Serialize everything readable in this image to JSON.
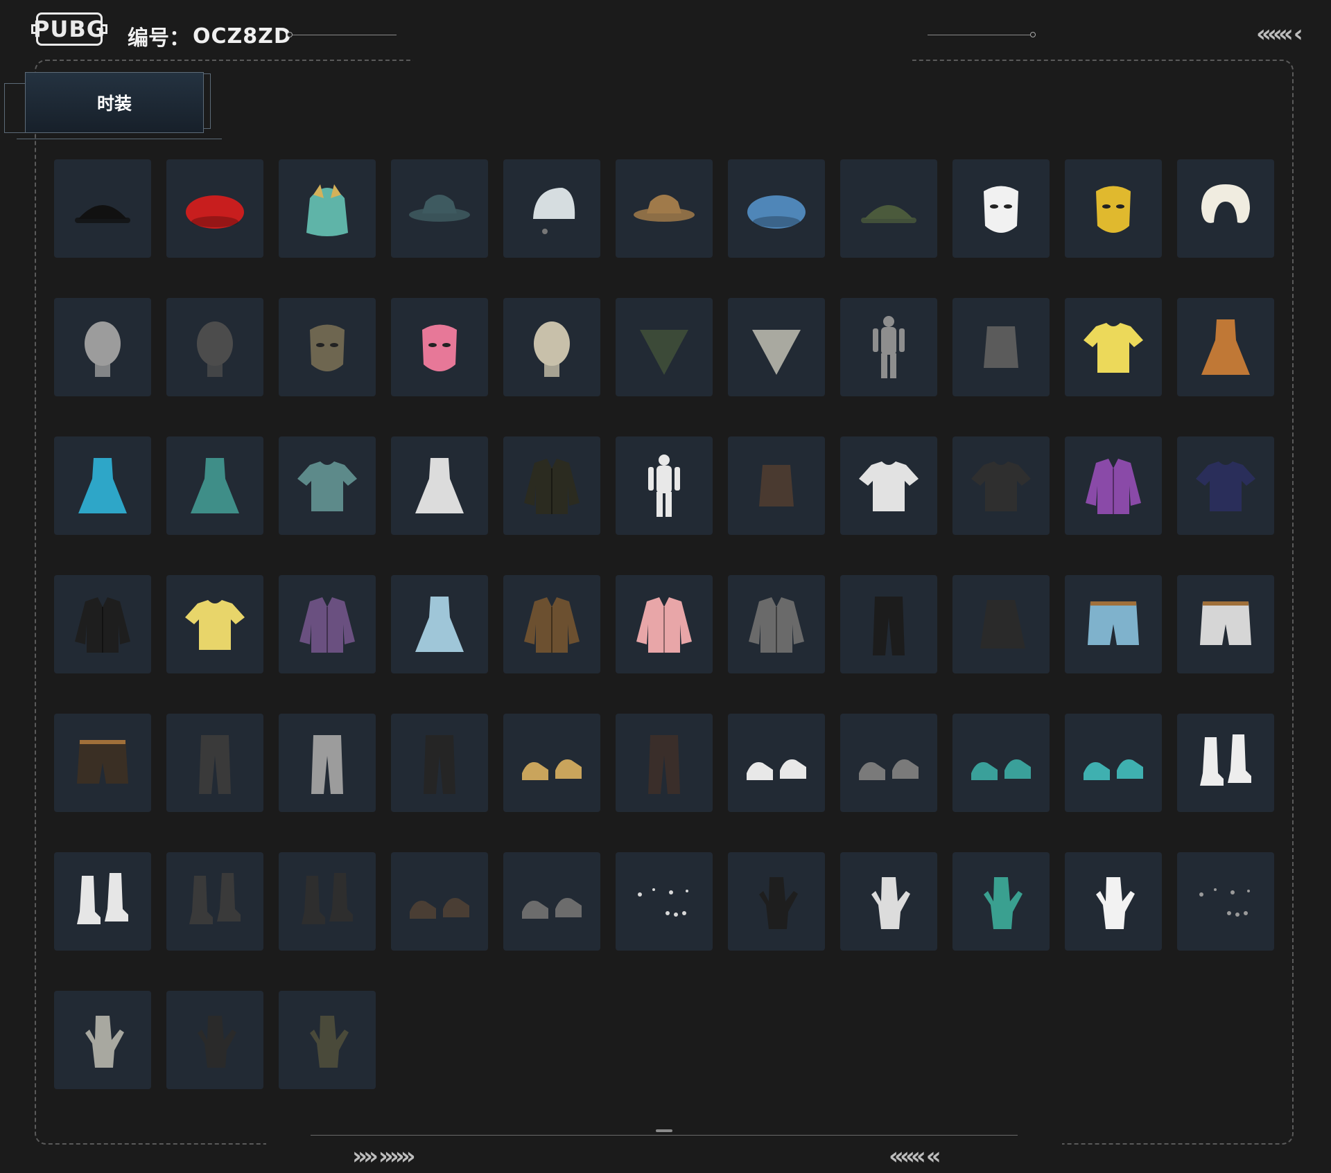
{
  "header": {
    "logo_text": "PUBG",
    "code_label": "编号：",
    "code_value": "OCZ8ZD",
    "chevrons_top_right": "«««  ‹"
  },
  "tabs": [
    {
      "label": "时装",
      "active": true
    }
  ],
  "footer": {
    "chevrons_left": "»» »»»",
    "chevrons_right": "««« «"
  },
  "colors": {
    "background": "#1b1b1b",
    "tile": "#222a34",
    "accent": "#5d6b78"
  },
  "items": [
    {
      "icon": "black-cap-icon",
      "color": "#111111",
      "shape": "cap"
    },
    {
      "icon": "red-beret-icon",
      "color": "#c81e1e",
      "shape": "beret"
    },
    {
      "icon": "furry-hat-icon",
      "color": "#5fb4a8",
      "shape": "fur"
    },
    {
      "icon": "bucket-hat-teal-icon",
      "color": "#3e5a60",
      "shape": "bucket"
    },
    {
      "icon": "white-beanie-icon",
      "color": "#d6dde0",
      "shape": "beanie"
    },
    {
      "icon": "leopard-bucket-hat-icon",
      "color": "#a07a4a",
      "shape": "bucket"
    },
    {
      "icon": "blue-plaid-beret-icon",
      "color": "#4f86b8",
      "shape": "beret"
    },
    {
      "icon": "headset-cap-icon",
      "color": "#4b5a3c",
      "shape": "cap"
    },
    {
      "icon": "chicken-mask-icon",
      "color": "#f1f1f1",
      "shape": "mask"
    },
    {
      "icon": "gold-mask-icon",
      "color": "#e0b92e",
      "shape": "mask"
    },
    {
      "icon": "neck-pillow-icon",
      "color": "#f0ece0",
      "shape": "pillow"
    },
    {
      "icon": "bald-head-icon",
      "color": "#9c9c9c",
      "shape": "head"
    },
    {
      "icon": "tactical-mask-icon",
      "color": "#4c4c4c",
      "shape": "head"
    },
    {
      "icon": "wolf-mask-icon",
      "color": "#6e6650",
      "shape": "mask"
    },
    {
      "icon": "pink-mask-icon",
      "color": "#e77898",
      "shape": "mask"
    },
    {
      "icon": "skull-mask-icon",
      "color": "#c8c0aa",
      "shape": "head"
    },
    {
      "icon": "bandana-green-icon",
      "color": "#3c4a38",
      "shape": "bandana"
    },
    {
      "icon": "bandana-checkered-icon",
      "color": "#a9a9a0",
      "shape": "bandana"
    },
    {
      "icon": "full-suit-icon",
      "color": "#8e8e8e",
      "shape": "suit"
    },
    {
      "icon": "chain-top-icon",
      "color": "#5b5b5b",
      "shape": "top"
    },
    {
      "icon": "yellow-tshirt-icon",
      "color": "#ecd95a",
      "shape": "shirt"
    },
    {
      "icon": "leopard-dress-icon",
      "color": "#c07836",
      "shape": "dress"
    },
    {
      "icon": "blue-dress-icon",
      "color": "#2ea6c8",
      "shape": "dress"
    },
    {
      "icon": "teal-dress-icon",
      "color": "#3f8e88",
      "shape": "dress"
    },
    {
      "icon": "floral-shirt-icon",
      "color": "#5d8a8a",
      "shape": "shirt"
    },
    {
      "icon": "white-outfit-icon",
      "color": "#dcdcdc",
      "shape": "dress"
    },
    {
      "icon": "black-jacket-gold-icon",
      "color": "#2b2b20",
      "shape": "jacket"
    },
    {
      "icon": "spotted-outfit-icon",
      "color": "#e8e8e8",
      "shape": "suit"
    },
    {
      "icon": "leather-vest-icon",
      "color": "#4a3a30",
      "shape": "top"
    },
    {
      "icon": "white-shirt-icon",
      "color": "#e2e2e2",
      "shape": "shirt"
    },
    {
      "icon": "black-tshirt-icon",
      "color": "#2f2f2f",
      "shape": "shirt"
    },
    {
      "icon": "purple-jacket-icon",
      "color": "#8a4aa8",
      "shape": "jacket"
    },
    {
      "icon": "navy-sweater-icon",
      "color": "#2a2e5a",
      "shape": "shirt"
    },
    {
      "icon": "black-hoodie-icon",
      "color": "#1e1e1e",
      "shape": "jacket"
    },
    {
      "icon": "yellow-sweater-icon",
      "color": "#e8d56a",
      "shape": "shirt"
    },
    {
      "icon": "purple-bomber-icon",
      "color": "#6a5080",
      "shape": "jacket"
    },
    {
      "icon": "nurse-outfit-icon",
      "color": "#9fc6d8",
      "shape": "dress"
    },
    {
      "icon": "leopard-coat-icon",
      "color": "#6c5030",
      "shape": "jacket"
    },
    {
      "icon": "pink-hoodie-icon",
      "color": "#e8a6a8",
      "shape": "jacket"
    },
    {
      "icon": "grey-jacket-icon",
      "color": "#6a6a6a",
      "shape": "jacket"
    },
    {
      "icon": "black-pants-icon",
      "color": "#1c1c1c",
      "shape": "pants"
    },
    {
      "icon": "black-skirt-icon",
      "color": "#2a2a2a",
      "shape": "skirt"
    },
    {
      "icon": "denim-shorts-icon",
      "color": "#7fb2cc",
      "shape": "shorts"
    },
    {
      "icon": "white-shorts-icon",
      "color": "#d6d6d6",
      "shape": "shorts"
    },
    {
      "icon": "leopard-shorts-icon",
      "color": "#3a2f24",
      "shape": "shorts"
    },
    {
      "icon": "grey-jeans-icon",
      "color": "#3a3a3a",
      "shape": "pants"
    },
    {
      "icon": "grey-joggers-icon",
      "color": "#9c9c9c",
      "shape": "pants"
    },
    {
      "icon": "black-leggings-icon",
      "color": "#252525",
      "shape": "pants"
    },
    {
      "icon": "tan-boots-icon",
      "color": "#c9a45c",
      "shape": "shoes"
    },
    {
      "icon": "stockings-icon",
      "color": "#3a2e2a",
      "shape": "pants"
    },
    {
      "icon": "sandals-icon",
      "color": "#e8e8e8",
      "shape": "shoes"
    },
    {
      "icon": "grey-sneakers-icon",
      "color": "#7a7a7a",
      "shape": "shoes"
    },
    {
      "icon": "teal-boots-icon",
      "color": "#3aa09a",
      "shape": "shoes"
    },
    {
      "icon": "teal-clogs-icon",
      "color": "#3fb0b0",
      "shape": "shoes"
    },
    {
      "icon": "white-boots-icon",
      "color": "#ededed",
      "shape": "boots"
    },
    {
      "icon": "white-slouch-boots-icon",
      "color": "#e6e6e6",
      "shape": "boots"
    },
    {
      "icon": "leopard-boots-icon",
      "color": "#3a3a3a",
      "shape": "boots"
    },
    {
      "icon": "fur-boots-icon",
      "color": "#2e2e2e",
      "shape": "boots"
    },
    {
      "icon": "brown-shoes-icon",
      "color": "#4a3e34",
      "shape": "shoes"
    },
    {
      "icon": "grey-chelsea-boots-icon",
      "color": "#6c6c6c",
      "shape": "shoes"
    },
    {
      "icon": "piercings-icon",
      "color": "#d8d8d8",
      "shape": "dots"
    },
    {
      "icon": "black-gloves-icon",
      "color": "#1e1e1e",
      "shape": "glove"
    },
    {
      "icon": "flower-hand-icon",
      "color": "#dcdcdc",
      "shape": "glove"
    },
    {
      "icon": "teal-fingerless-gloves-icon",
      "color": "#3aa090",
      "shape": "glove"
    },
    {
      "icon": "white-gloves-icon",
      "color": "#f2f2f2",
      "shape": "glove"
    },
    {
      "icon": "claws-bracelet-icon",
      "color": "#9a9a9a",
      "shape": "dots"
    },
    {
      "icon": "wrapped-hands-icon",
      "color": "#a8a8a0",
      "shape": "glove"
    },
    {
      "icon": "black-fingerless-gloves-icon",
      "color": "#2a2a2a",
      "shape": "glove"
    },
    {
      "icon": "tactical-gloves-icon",
      "color": "#4a4a3a",
      "shape": "glove"
    }
  ]
}
